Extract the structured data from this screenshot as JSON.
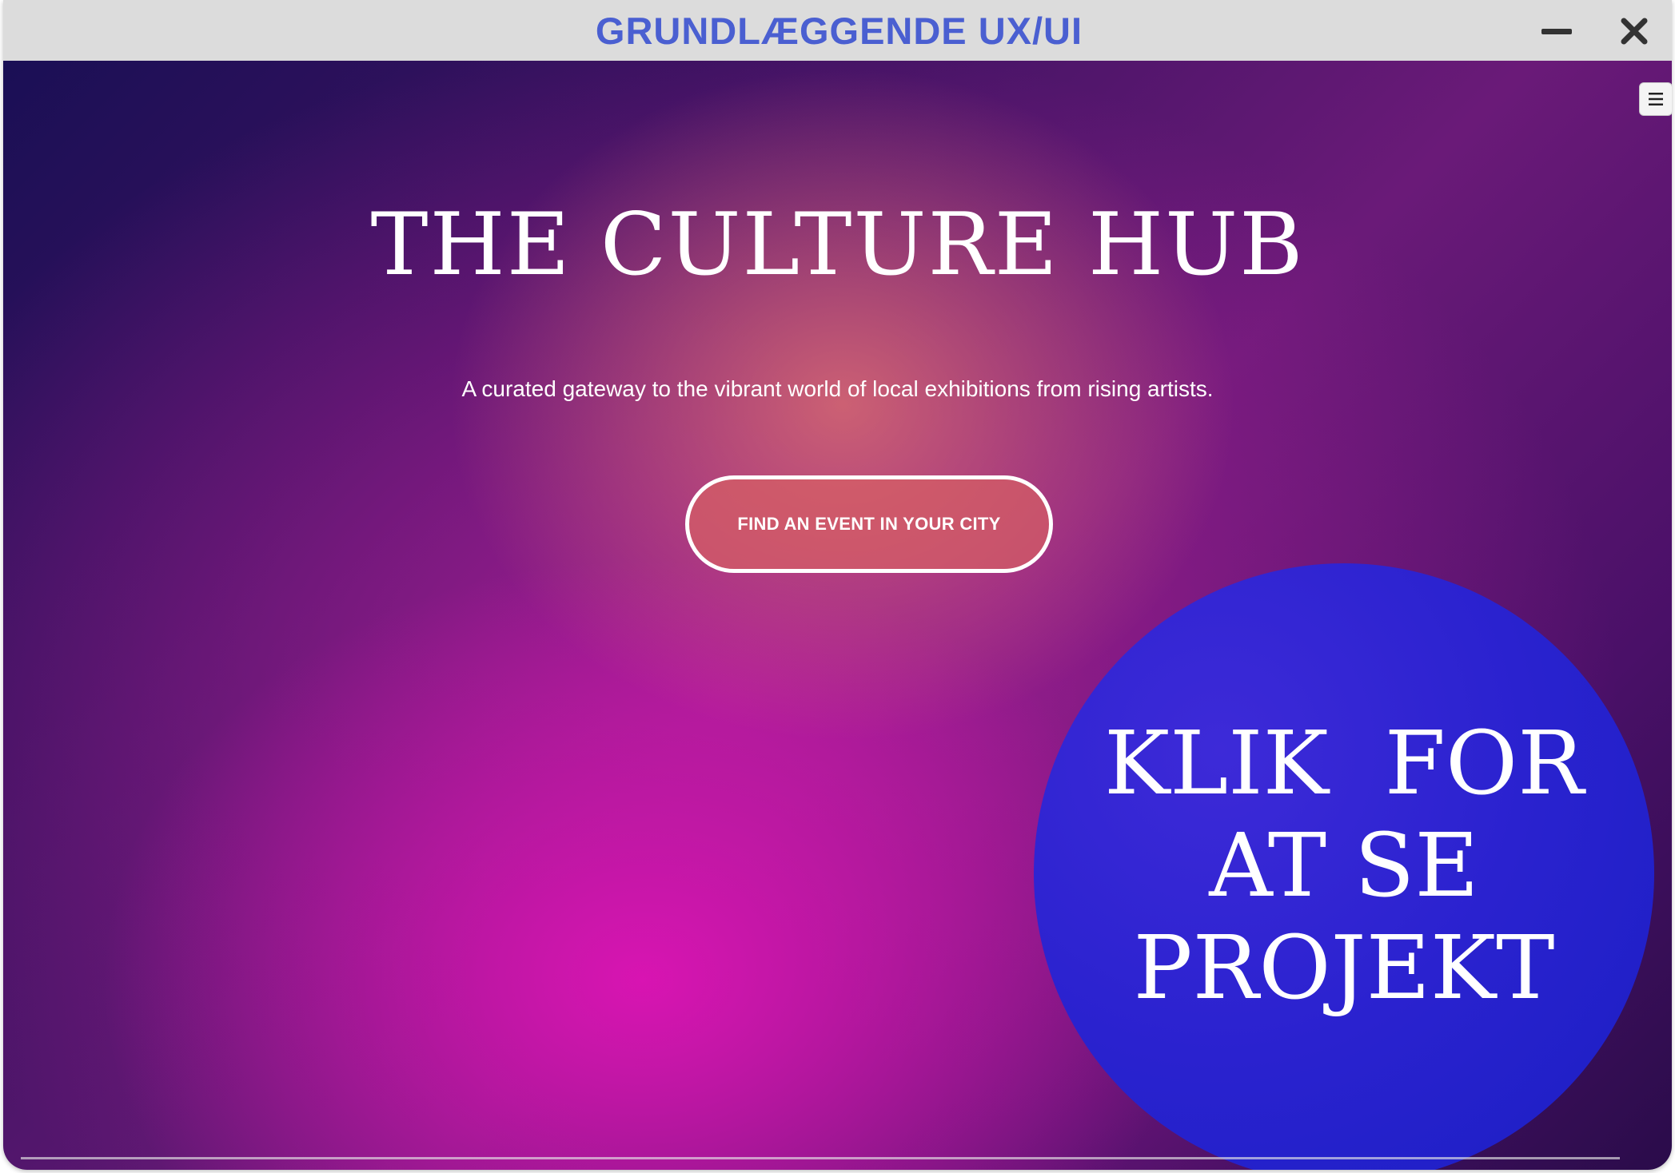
{
  "window": {
    "title": "GRUNDLÆGGENDE UX/UI",
    "minimize_icon": "minus-icon",
    "close_icon": "close-icon",
    "title_color": "#4a5fd1"
  },
  "page": {
    "menu_icon": "hamburger-menu-icon",
    "hero_title": "THE CULTURE HUB",
    "tagline": "A curated gateway to the vibrant world of local exhibitions from rising artists.",
    "cta_label": "FIND AN EVENT IN YOUR CITY"
  },
  "overlay": {
    "line1": "KLIK  FOR",
    "line2": "AT SE",
    "line3": "PROJEKT",
    "color": "#2a22cf"
  }
}
